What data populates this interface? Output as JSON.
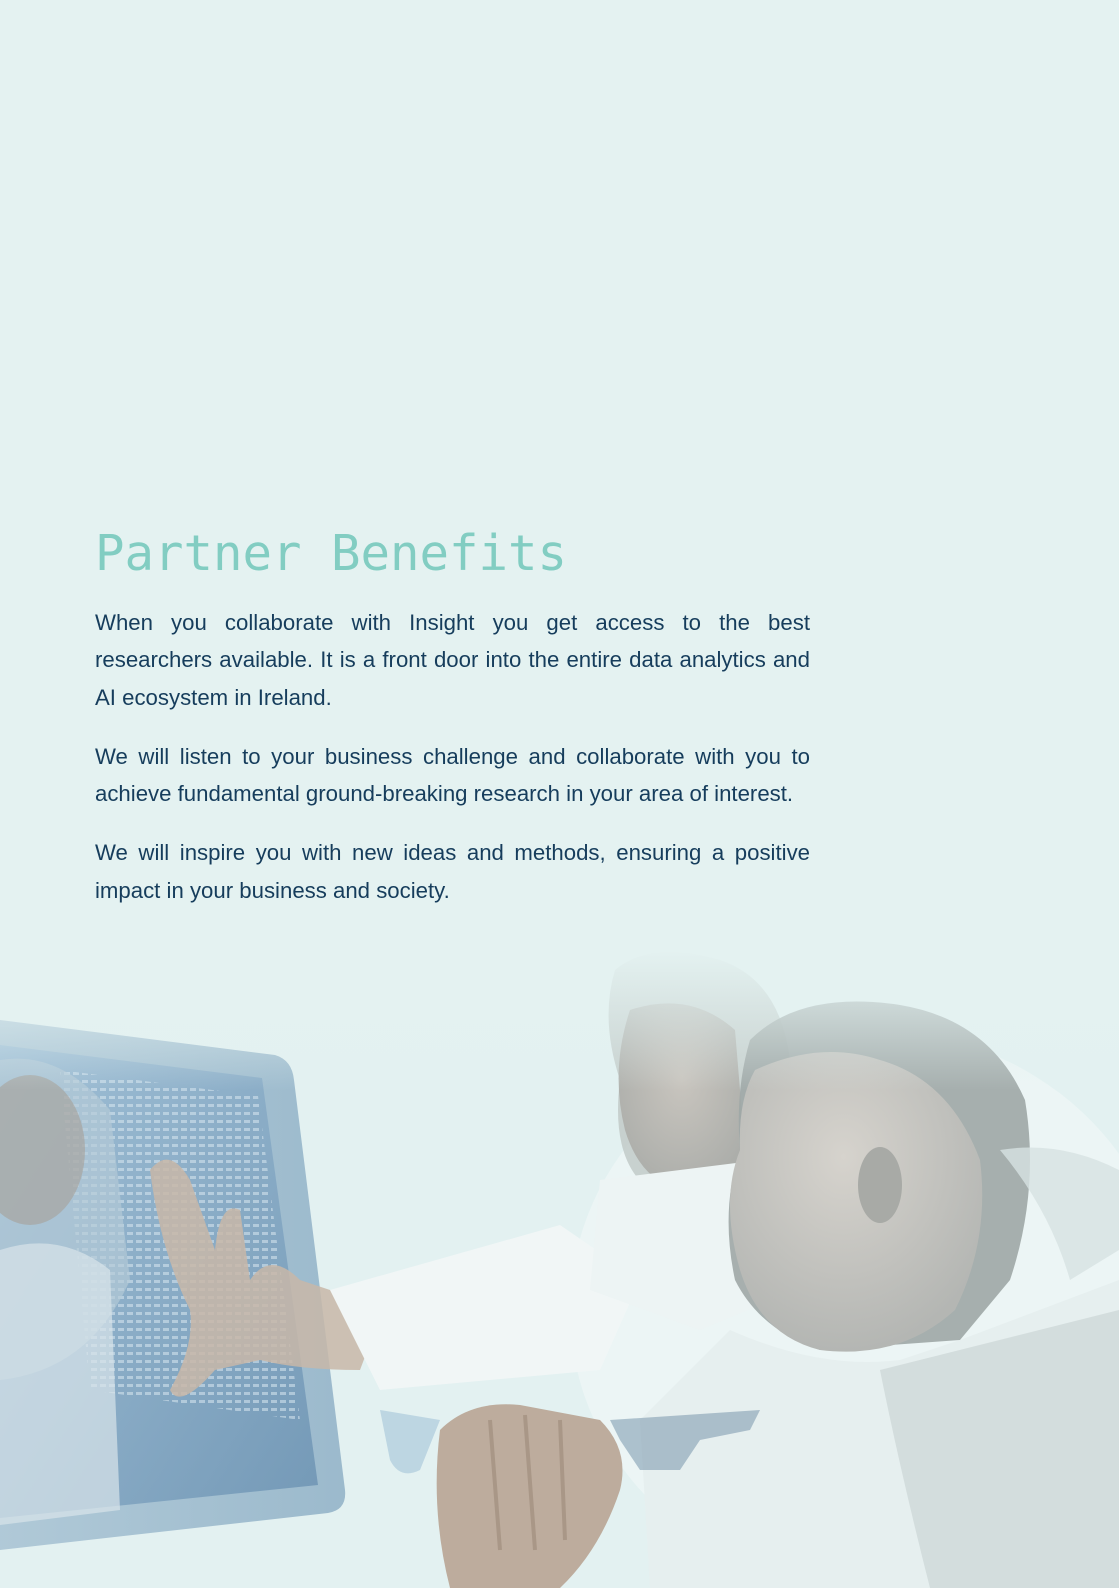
{
  "section": {
    "title": "Partner Benefits",
    "paragraphs": [
      "When you collaborate with Insight you get access to the best researchers available. It is a front door into the entire data analytics and AI ecosystem in Ireland.",
      "We will listen to your business challenge and collaborate with you to achieve fundamental  ground-breaking research in your area of interest.",
      "We will inspire you with new ideas and methods, ensuring a positive impact in your business and society."
    ]
  },
  "colors": {
    "background": "#e4f2f1",
    "title": "#82cdc2",
    "body_text": "#163d5c"
  }
}
